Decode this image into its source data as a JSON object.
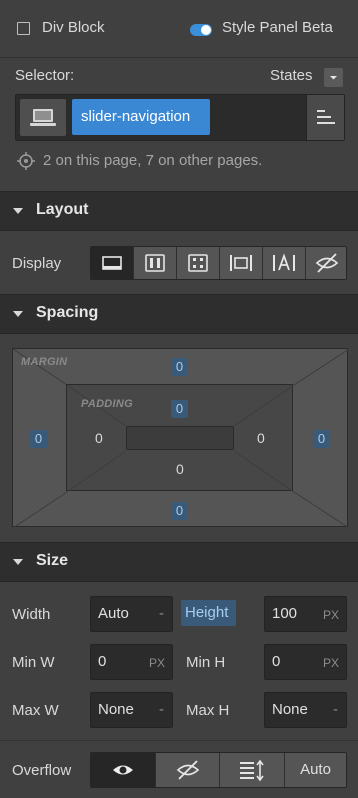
{
  "header": {
    "element_type": "Div Block",
    "style_panel_label": "Style Panel Beta",
    "style_panel_enabled": true
  },
  "selector": {
    "label": "Selector:",
    "states_label": "States",
    "class_name": "slider-navigation",
    "usage_text": "2 on this page, 7 on other pages."
  },
  "layout": {
    "title": "Layout",
    "display_label": "Display",
    "display_options": [
      "block-icon",
      "flex-icon",
      "grid-icon",
      "inline-block-icon",
      "inline-icon",
      "none-icon"
    ],
    "display_active": "block"
  },
  "spacing": {
    "title": "Spacing",
    "margin_label": "MARGIN",
    "padding_label": "PADDING",
    "margin": {
      "top": "0",
      "right": "0",
      "bottom": "0",
      "left": "0"
    },
    "padding": {
      "top": "0",
      "right": "0",
      "bottom": "0",
      "left": "0"
    }
  },
  "size": {
    "title": "Size",
    "width_label": "Width",
    "width_value": "Auto",
    "width_unit": "-",
    "height_label": "Height",
    "height_value": "100",
    "height_unit": "PX",
    "min_w_label": "Min W",
    "min_w_value": "0",
    "min_w_unit": "PX",
    "min_h_label": "Min H",
    "min_h_value": "0",
    "min_h_unit": "PX",
    "max_w_label": "Max W",
    "max_w_value": "None",
    "max_w_unit": "-",
    "max_h_label": "Max H",
    "max_h_value": "None",
    "max_h_unit": "-"
  },
  "overflow": {
    "label": "Overflow",
    "options": [
      "visible-icon",
      "hidden-icon",
      "scroll-icon"
    ],
    "auto_label": "Auto",
    "active": "visible"
  },
  "colors": {
    "accent": "#3a87d4",
    "panel_bg": "#404040",
    "section_head_bg": "#2e2e2e"
  }
}
